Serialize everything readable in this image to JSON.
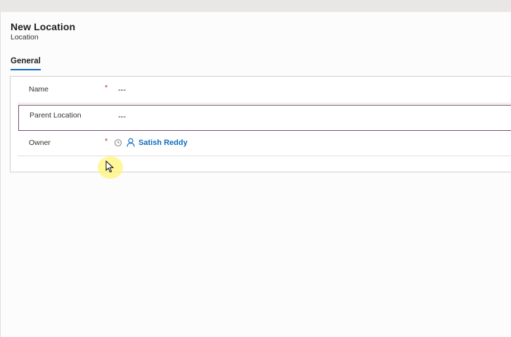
{
  "header": {
    "title": "New Location",
    "subtitle": "Location"
  },
  "tabs": [
    {
      "label": "General",
      "active": true
    }
  ],
  "form": {
    "fields": [
      {
        "label": "Name",
        "required": true,
        "value": "---"
      },
      {
        "label": "Parent Location",
        "required": false,
        "value": "---"
      },
      {
        "label": "Owner",
        "required": true,
        "value": "Satish Reddy"
      }
    ],
    "required_marker": "*"
  },
  "icons": {
    "owner_status": "clock-icon",
    "owner_type": "person-icon",
    "pointer": "mouse-cursor-icon"
  },
  "colors": {
    "accent": "#0f6cbd",
    "required": "#c4314b",
    "focus_border": "#7a4a6e",
    "cursor_highlight": "#fff478"
  }
}
